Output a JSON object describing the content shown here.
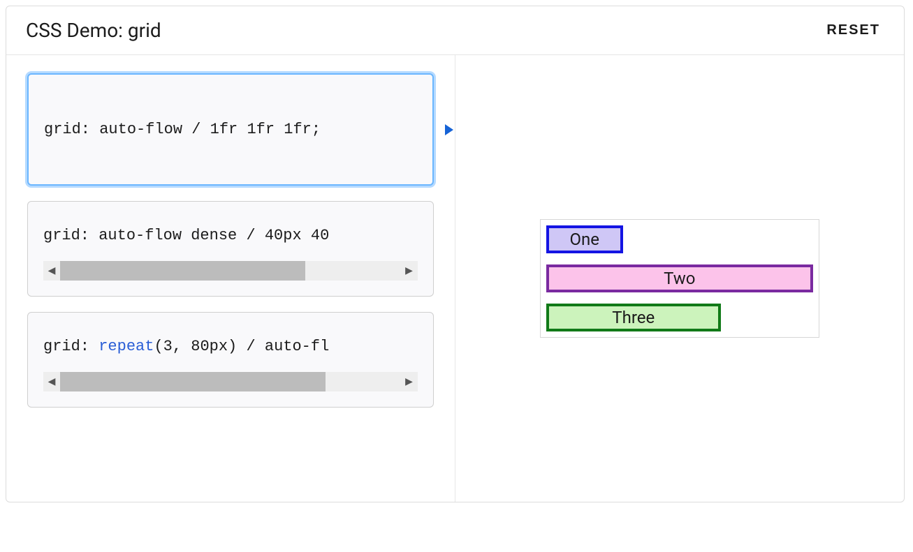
{
  "header": {
    "title": "CSS Demo: grid",
    "reset_label": "RESET"
  },
  "options": [
    {
      "code_plain": "grid: auto-flow / 1fr 1fr 1fr;",
      "selected": true,
      "has_scroll": false
    },
    {
      "code_prefix": "grid: auto-flow dense / 40px 40",
      "selected": false,
      "has_scroll": true,
      "scroll_thumb_left_pct": 0,
      "scroll_thumb_width_pct": 72
    },
    {
      "code_prefix_before_kw": "grid: ",
      "code_kw": "repeat",
      "code_prefix_after_kw": "(3, 80px) / auto-fl",
      "selected": false,
      "has_scroll": true,
      "scroll_thumb_left_pct": 0,
      "scroll_thumb_width_pct": 78
    }
  ],
  "output": {
    "cell1": "One",
    "cell2": "Two",
    "cell3": "Three"
  },
  "scroll_arrows": {
    "left": "◀",
    "right": "▶"
  }
}
